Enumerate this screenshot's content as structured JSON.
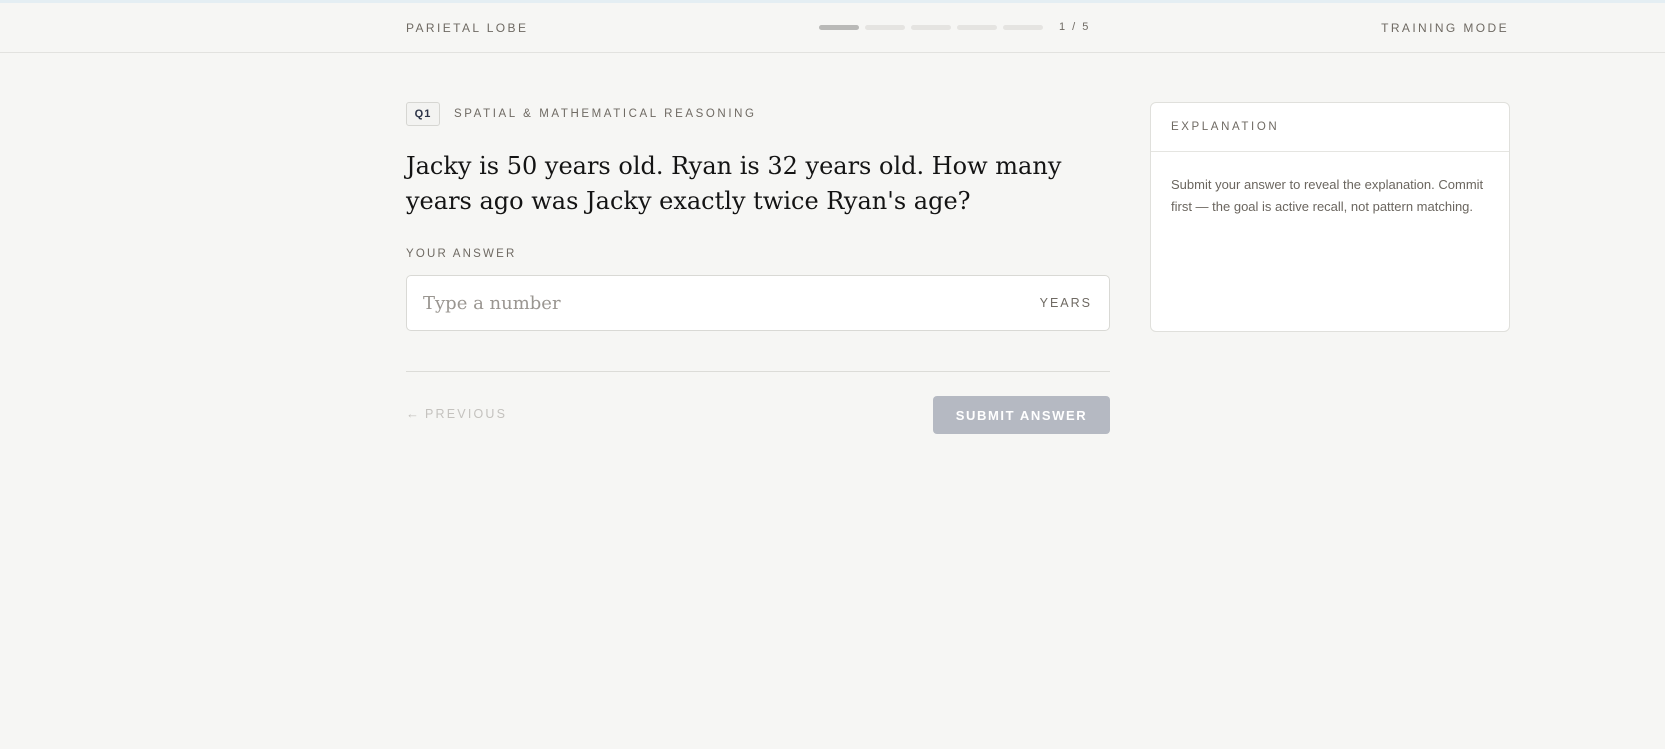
{
  "header": {
    "brand": "PARIETAL LOBE",
    "progress": {
      "total": 5,
      "current": 1
    },
    "counter": "1 / 5",
    "mode": "TRAINING MODE"
  },
  "question": {
    "badge": "Q1",
    "category": "SPATIAL & MATHEMATICAL REASONING",
    "text": "Jacky is 50 years old. Ryan is 32 years old. How many years ago was Jacky exactly twice Ryan's age?"
  },
  "answer": {
    "label": "YOUR ANSWER",
    "value": "",
    "placeholder": "Type a number",
    "unit": "YEARS"
  },
  "nav": {
    "previous_label": "PREVIOUS",
    "previous_icon": "arrow-left-icon",
    "submit_label": "SUBMIT ANSWER"
  },
  "explanation": {
    "title": "EXPLANATION",
    "body": "Submit your answer to reveal the explanation. Commit first — the goal is active recall, not pattern matching."
  }
}
